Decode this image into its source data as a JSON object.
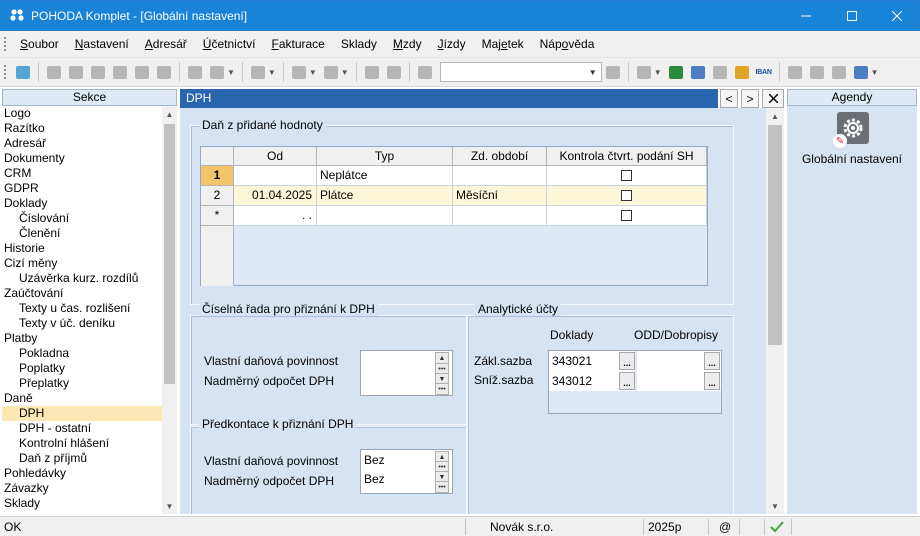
{
  "window": {
    "title": "POHODA Komplet - [Globální nastavení]"
  },
  "menu": [
    {
      "label": "Soubor",
      "u": "S",
      "rest": "oubor"
    },
    {
      "label": "Nastavení",
      "u": "N",
      "rest": "astavení"
    },
    {
      "label": "Adresář",
      "u": "A",
      "rest": "dresář"
    },
    {
      "label": "Účetnictví",
      "u": "Ú",
      "rest": "četnictví"
    },
    {
      "label": "Fakturace",
      "u": "F",
      "rest": "akturace"
    },
    {
      "label": "Sklady",
      "u": "S",
      "rest": "klady",
      "plain": true
    },
    {
      "label": "Mzdy",
      "u": "M",
      "rest": "zdy"
    },
    {
      "label": "Jízdy",
      "u": "J",
      "rest": "ízdy"
    },
    {
      "label": "Majetek",
      "pre": "Maj",
      "u": "e",
      "rest": "tek"
    },
    {
      "label": "Nápověda",
      "pre": "Náp",
      "u": "o",
      "rest": "věda"
    }
  ],
  "toolbar": {
    "combo_value": "",
    "iban_label": "IBAN"
  },
  "sekce": {
    "header": "Sekce",
    "items": [
      {
        "label": "Logo",
        "level": 1
      },
      {
        "label": "Razítko",
        "level": 1
      },
      {
        "label": "Adresář",
        "level": 1
      },
      {
        "label": "Dokumenty",
        "level": 1
      },
      {
        "label": "CRM",
        "level": 1
      },
      {
        "label": "GDPR",
        "level": 1
      },
      {
        "label": "Doklady",
        "level": 1
      },
      {
        "label": "Číslování",
        "level": 2
      },
      {
        "label": "Členění",
        "level": 2
      },
      {
        "label": "Historie",
        "level": 1
      },
      {
        "label": "Cizí měny",
        "level": 1
      },
      {
        "label": "Uzávěrka kurz. rozdílů",
        "level": 2
      },
      {
        "label": "Zaúčtování",
        "level": 1
      },
      {
        "label": "Texty u čas. rozlišení",
        "level": 2
      },
      {
        "label": "Texty v úč. deníku",
        "level": 2
      },
      {
        "label": "Platby",
        "level": 1
      },
      {
        "label": "Pokladna",
        "level": 2
      },
      {
        "label": "Poplatky",
        "level": 2
      },
      {
        "label": "Přeplatky",
        "level": 2
      },
      {
        "label": "Daně",
        "level": 1
      },
      {
        "label": "DPH",
        "level": 2,
        "selected": true
      },
      {
        "label": "DPH - ostatní",
        "level": 2
      },
      {
        "label": "Kontrolní hlášení",
        "level": 2
      },
      {
        "label": "Daň z příjmů",
        "level": 2
      },
      {
        "label": "Pohledávky",
        "level": 1
      },
      {
        "label": "Závazky",
        "level": 1
      },
      {
        "label": "Sklady",
        "level": 1
      }
    ]
  },
  "main": {
    "header": "DPH",
    "nav_prev": "<",
    "nav_next": ">",
    "vat_group": {
      "title": "Daň z přidané hodnoty",
      "columns": [
        "Od",
        "Typ",
        "Zd. období",
        "Kontrola čtvrt. podání SH"
      ],
      "rows": [
        {
          "num": "1",
          "od": "",
          "typ": "Neplátce",
          "obdobi": "",
          "kontrola": false,
          "current": true
        },
        {
          "num": "2",
          "od": "01.04.2025",
          "typ": "Plátce",
          "obdobi": "Měsíční",
          "kontrola": false,
          "current": false
        },
        {
          "num": "*",
          "od": ". .",
          "typ": "",
          "obdobi": "",
          "kontrola": false,
          "current": false
        }
      ]
    },
    "ciselna_rada": {
      "title": "Číselná řada pro přiznání k DPH",
      "vlastni_label": "Vlastní daňová povinnost",
      "nadmerny_label": "Nadměrný odpočet DPH",
      "vlastni_value": "",
      "nadmerny_value": ""
    },
    "predkontace": {
      "title": "Předkontace k přiznání DPH",
      "vlastni_label": "Vlastní daňová povinnost",
      "nadmerny_label": "Nadměrný odpočet DPH",
      "vlastni_value": "Bez",
      "nadmerny_value": "Bez"
    },
    "analyticke": {
      "title": "Analytické účty",
      "col_doklady": "Doklady",
      "col_odd": "ODD/Dobropisy",
      "zakl_label": "Zákl.sazba",
      "sniz_label": "Sníž.sazba",
      "zakl_doklady": "343021",
      "sniz_doklady": "343012",
      "zakl_odd": "",
      "sniz_odd": ""
    }
  },
  "agendy": {
    "header": "Agendy",
    "item_label": "Globální nastavení"
  },
  "status": {
    "left": "OK",
    "company": "Novák s.r.o.",
    "year": "2025p",
    "at": "@"
  }
}
